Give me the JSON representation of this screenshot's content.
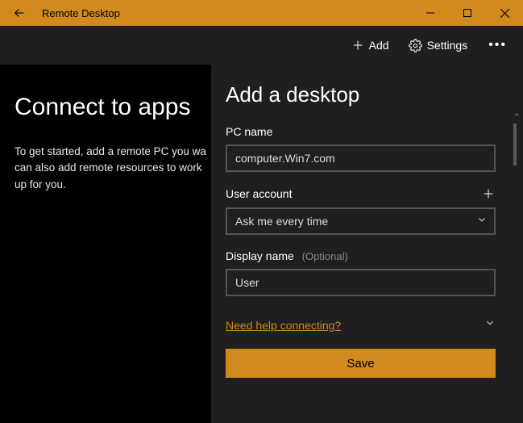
{
  "titlebar": {
    "app_title": "Remote Desktop"
  },
  "toolbar": {
    "add_label": "Add",
    "settings_label": "Settings"
  },
  "left": {
    "heading": "Connect to apps",
    "body_line1": "To get started, add a remote PC you wa",
    "body_line2": "can also add remote resources to work",
    "body_line3": "up for you."
  },
  "panel": {
    "heading": "Add a desktop",
    "pc_name_label": "PC name",
    "pc_name_value": "computer.Win7.com",
    "user_account_label": "User account",
    "user_account_value": "Ask me every time",
    "display_name_label": "Display name",
    "display_name_optional": "(Optional)",
    "display_name_value": "User",
    "help_link": "Need help connecting?",
    "save_label": "Save"
  }
}
